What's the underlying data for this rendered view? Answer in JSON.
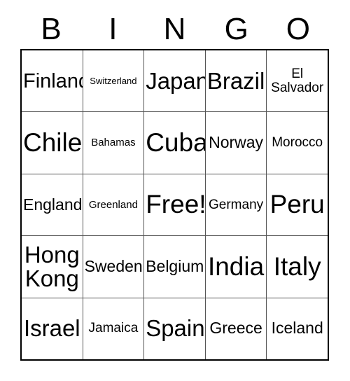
{
  "card": {
    "title": "BINGO",
    "header_letters": [
      "B",
      "I",
      "N",
      "G",
      "O"
    ],
    "free_space_label": "Free!",
    "colors": {
      "background": "#ffffff",
      "text": "#000000",
      "outer_border": "#000000",
      "inner_border": "#555555"
    },
    "rows": [
      [
        {
          "label": "Finland",
          "size": "sz-l"
        },
        {
          "label": "Switzerland",
          "size": "sz-xxs"
        },
        {
          "label": "Japan",
          "size": "sz-xl"
        },
        {
          "label": "Brazil",
          "size": "sz-xl"
        },
        {
          "label": "El Salvador",
          "size": "sz-s"
        }
      ],
      [
        {
          "label": "Chile",
          "size": "sz-xxl"
        },
        {
          "label": "Bahamas",
          "size": "sz-xs"
        },
        {
          "label": "Cuba",
          "size": "sz-xxl"
        },
        {
          "label": "Norway",
          "size": "sz-m"
        },
        {
          "label": "Morocco",
          "size": "sz-s"
        }
      ],
      [
        {
          "label": "England",
          "size": "sz-m"
        },
        {
          "label": "Greenland",
          "size": "sz-xs"
        },
        {
          "label": "Free!",
          "size": "sz-xxl"
        },
        {
          "label": "Germany",
          "size": "sz-s"
        },
        {
          "label": "Peru",
          "size": "sz-xxl"
        }
      ],
      [
        {
          "label": "Hong Kong",
          "size": "sz-xl"
        },
        {
          "label": "Sweden",
          "size": "sz-m"
        },
        {
          "label": "Belgium",
          "size": "sz-m"
        },
        {
          "label": "India",
          "size": "sz-xxl"
        },
        {
          "label": "Italy",
          "size": "sz-xxl"
        }
      ],
      [
        {
          "label": "Israel",
          "size": "sz-xl"
        },
        {
          "label": "Jamaica",
          "size": "sz-s"
        },
        {
          "label": "Spain",
          "size": "sz-xl"
        },
        {
          "label": "Greece",
          "size": "sz-m"
        },
        {
          "label": "Iceland",
          "size": "sz-m"
        }
      ]
    ]
  }
}
